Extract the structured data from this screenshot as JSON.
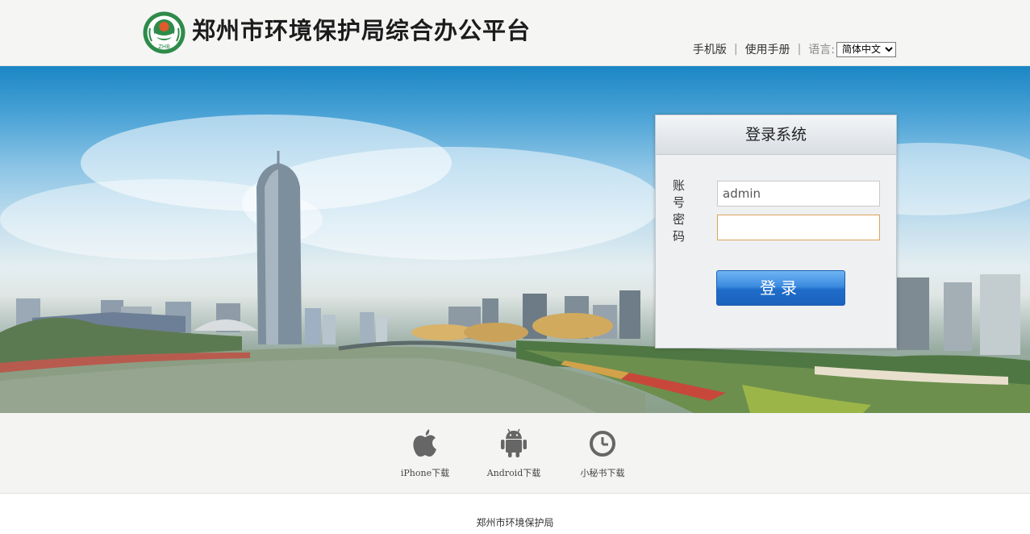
{
  "header": {
    "title": "郑州市环境保护局综合办公平台",
    "logo_text": "ZHB",
    "nav": {
      "mobile_label": "手机版",
      "manual_label": "使用手册",
      "language_label": "语言:",
      "language_selected": "简体中文",
      "separator": "|"
    }
  },
  "login": {
    "title": "登录系统",
    "account_label": "账 号",
    "account_value": "admin",
    "password_label": "密 码",
    "password_value": "",
    "submit_label": "登录"
  },
  "downloads": {
    "items": [
      {
        "label": "iPhone下载",
        "icon": "apple-icon"
      },
      {
        "label": "Android下载",
        "icon": "android-icon"
      },
      {
        "label": "小秘书下载",
        "icon": "clock-icon"
      }
    ]
  },
  "footer": {
    "org_name": "郑州市环境保护局"
  },
  "colors": {
    "accent_blue": "#1f6cc9",
    "logo_green": "#2e8b4a",
    "focus_border": "#e0a35a"
  }
}
